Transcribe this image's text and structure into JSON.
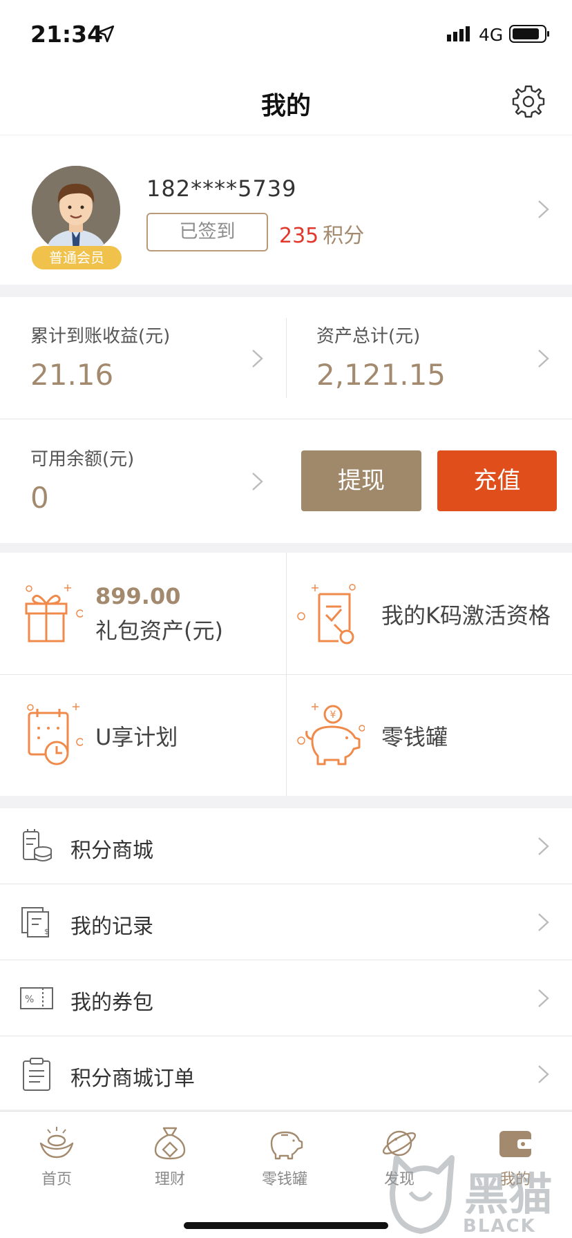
{
  "status_bar": {
    "time": "21:34",
    "network": "4G"
  },
  "nav": {
    "title": "我的"
  },
  "profile": {
    "phone": "182****5739",
    "member_badge": "普通会员",
    "signed_label": "已签到",
    "points_value": "235",
    "points_unit": "积分"
  },
  "assets": {
    "cumulative_label": "累计到账收益(元)",
    "cumulative_value": "21.16",
    "total_label": "资产总计(元)",
    "total_value": "2,121.15",
    "balance_label": "可用余额(元)",
    "balance_value": "0",
    "withdraw_label": "提现",
    "recharge_label": "充值"
  },
  "features": {
    "gift_amount": "899.00",
    "gift_label": "礼包资产(元)",
    "kcode_label": "我的K码激活资格",
    "uplan_label": "U享计划",
    "piggy_label": "零钱罐"
  },
  "menu": {
    "items": [
      {
        "label": "积分商城",
        "icon": "coins-icon"
      },
      {
        "label": "我的记录",
        "icon": "records-icon"
      },
      {
        "label": "我的券包",
        "icon": "coupon-icon"
      },
      {
        "label": "积分商城订单",
        "icon": "clipboard-icon"
      }
    ]
  },
  "tabbar": {
    "items": [
      {
        "label": "首页",
        "icon": "gold-ingot-icon"
      },
      {
        "label": "理财",
        "icon": "money-bag-icon"
      },
      {
        "label": "零钱罐",
        "icon": "piggy-bank-icon"
      },
      {
        "label": "发现",
        "icon": "planet-icon"
      },
      {
        "label": "我的",
        "icon": "wallet-icon"
      }
    ],
    "active": "我的"
  },
  "watermark": {
    "text": "黑猫",
    "subtext": "BLACK CAT"
  },
  "colors": {
    "accent_gold": "#a38a6e",
    "accent_orange": "#e04e1c",
    "points_red": "#e2382b",
    "icon_orange": "#f08a4b"
  }
}
